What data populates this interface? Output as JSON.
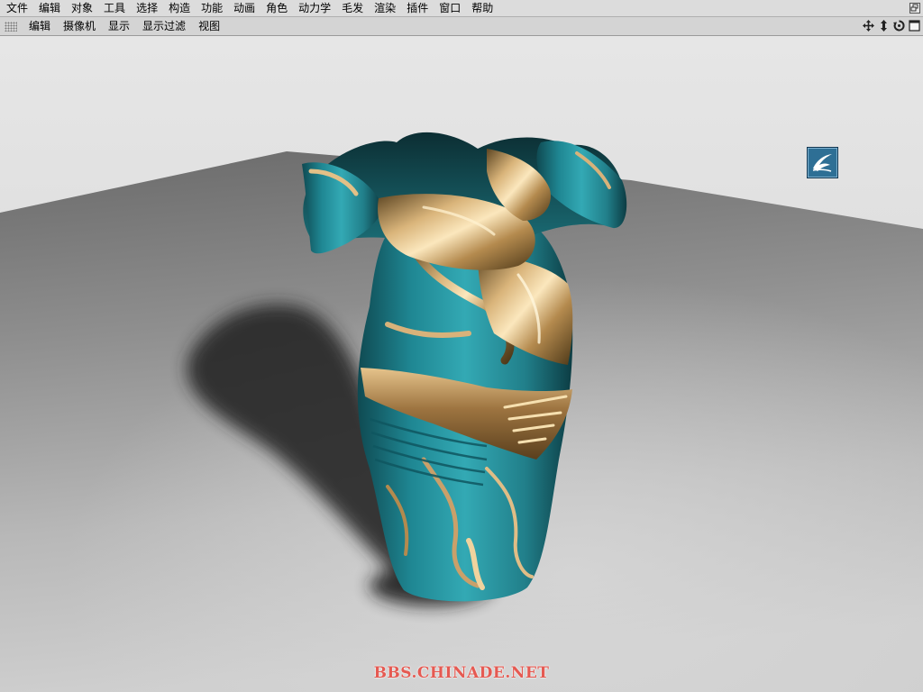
{
  "menubar": {
    "items": [
      "文件",
      "编辑",
      "对象",
      "工具",
      "选择",
      "构造",
      "功能",
      "动画",
      "角色",
      "动力学",
      "毛发",
      "渲染",
      "插件",
      "窗口",
      "帮助"
    ]
  },
  "viewport_menu": {
    "items": [
      "编辑",
      "摄像机",
      "显示",
      "显示过滤",
      "视图"
    ]
  },
  "nav_icons": [
    "move-view-icon",
    "zoom-view-icon",
    "rotate-view-icon",
    "maximize-view-icon"
  ],
  "colors": {
    "menubar_bg": "#dcdcdc",
    "vase_teal": "#2a9aa6",
    "vase_gold": "#b8935a",
    "watermark": "#e55a52",
    "badge_blue": "#2e6f95"
  },
  "watermark": "BBS.CHINADE.NET"
}
